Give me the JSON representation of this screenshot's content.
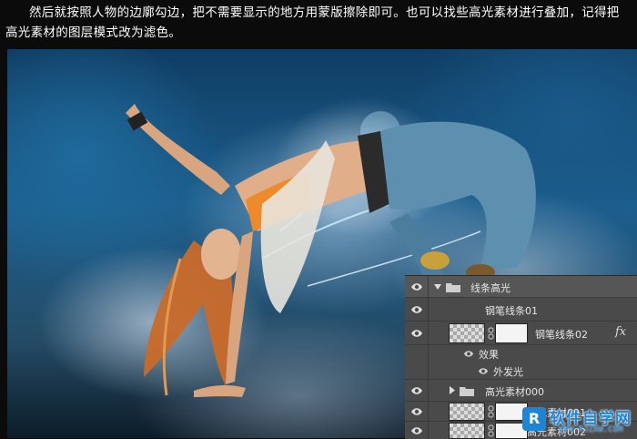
{
  "caption": {
    "line1": "然后就按照人物的边廓勾边，把不需要显示的地方用蒙版擦除即可。也可以找些高光素材进行叠加，记得把",
    "line2": "高光素材的图层模式改为滤色。"
  },
  "layers": {
    "rows": [
      {
        "label": "线条高光",
        "type": "group-open"
      },
      {
        "label": "钢笔线条01",
        "type": "layer"
      },
      {
        "label": "钢笔线条02",
        "type": "layer-mask-fx",
        "fx": "fx"
      },
      {
        "label": "效果",
        "type": "effects"
      },
      {
        "label": "外发光",
        "type": "effect"
      },
      {
        "label": "高光素材000",
        "type": "group-closed"
      },
      {
        "label": "高光素材001",
        "type": "layer-mask"
      },
      {
        "label": "高光素材002",
        "type": "layer-mask"
      }
    ]
  },
  "watermark": {
    "logo": "R",
    "text": "软件自学网",
    "url": "WWW.RJZXW.COM"
  }
}
